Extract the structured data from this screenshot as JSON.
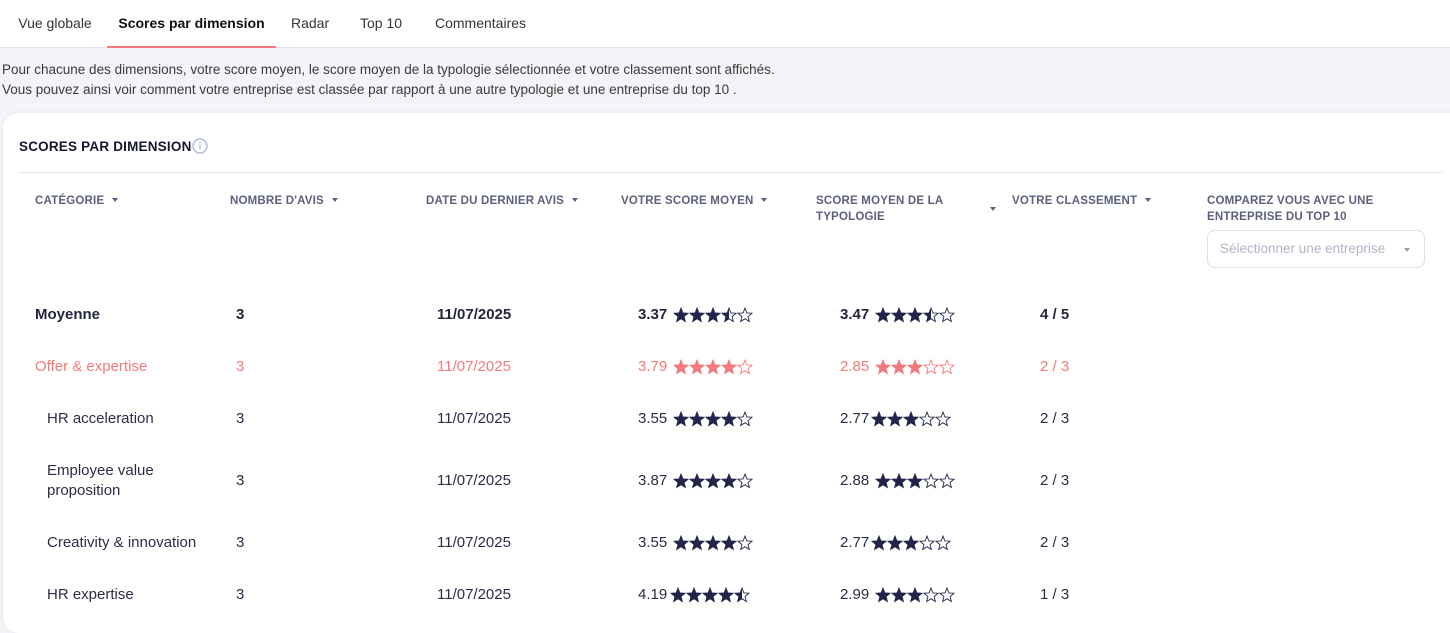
{
  "tabs": [
    "Vue globale",
    "Scores par dimension",
    "Radar",
    "Top 10",
    "Commentaires"
  ],
  "intro": {
    "line1": "Pour chacune des dimensions, votre score moyen, le score moyen de la typologie sélectionnée et votre classement sont affichés.",
    "line2": "Vous pouvez ainsi voir comment votre entreprise est classée par rapport à une autre typologie et une entreprise du top 10 ."
  },
  "card": {
    "title": "SCORES PAR DIMENSION",
    "headers": {
      "category": "CATÉGORIE",
      "reviews": "NOMBRE D'AVIS",
      "last_date": "DATE DU DERNIER AVIS",
      "your_score": "VOTRE SCORE MOYEN",
      "typology_score_1": "SCORE MOYEN DE LA",
      "typology_score_2": "TYPOLOGIE",
      "ranking": "VOTRE CLASSEMENT",
      "compare_1": "COMPAREZ VOUS AVEC UNE",
      "compare_2": "ENTREPRISE DU TOP 10"
    },
    "select_placeholder": "Sélectionner une entreprise"
  },
  "colors": {
    "accent": "#f27a7a",
    "navy": "#22244a",
    "text": "#2a2d45"
  },
  "rows": [
    {
      "name": "Moyenne",
      "reviews": "3",
      "date": "11/07/2025",
      "score": "3.37",
      "score_stars": 3.5,
      "typology": "3.47",
      "typology_stars": 3.5,
      "rank": "4 / 5"
    },
    {
      "name": "Offer & expertise",
      "reviews": "3",
      "date": "11/07/2025",
      "score": "3.79",
      "score_stars": 4,
      "typology": "2.85",
      "typology_stars": 3,
      "rank": "2 / 3"
    },
    {
      "name": "HR acceleration",
      "reviews": "3",
      "date": "11/07/2025",
      "score": "3.55",
      "score_stars": 4,
      "typology": "2.77",
      "typology_stars": 3,
      "rank": "2 / 3"
    },
    {
      "name_1": "Employee value",
      "name_2": "proposition",
      "reviews": "3",
      "date": "11/07/2025",
      "score": "3.87",
      "score_stars": 4,
      "typology": "2.88",
      "typology_stars": 3,
      "rank": "2 / 3"
    },
    {
      "name": "Creativity & innovation",
      "reviews": "3",
      "date": "11/07/2025",
      "score": "3.55",
      "score_stars": 4,
      "typology": "2.77",
      "typology_stars": 3,
      "rank": "2 / 3"
    },
    {
      "name": "HR expertise",
      "reviews": "3",
      "date": "11/07/2025",
      "score": "4.19",
      "score_stars": 4.5,
      "typology": "2.99",
      "typology_stars": 3,
      "rank": "1 / 3"
    }
  ]
}
